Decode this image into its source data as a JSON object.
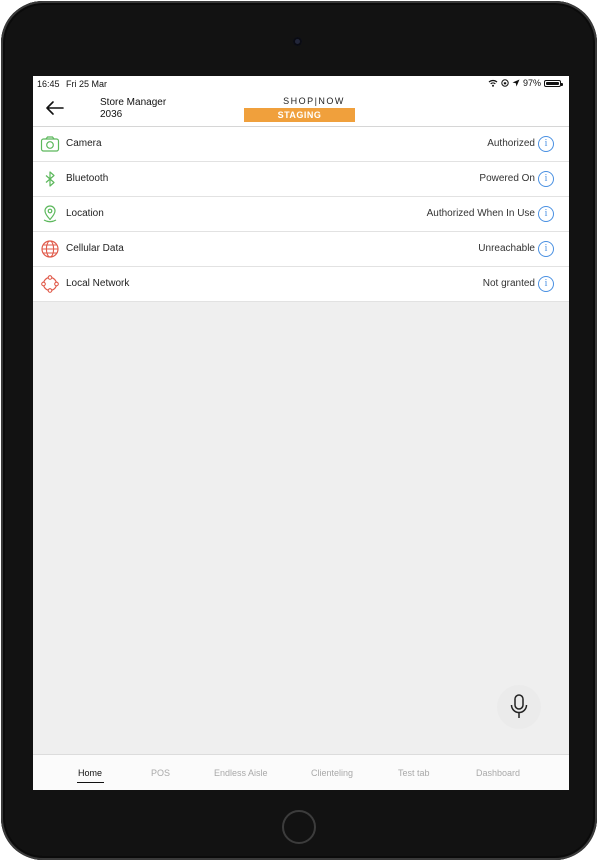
{
  "statusbar": {
    "time": "16:45",
    "date": "Fri 25 Mar",
    "battery": "97%",
    "battery_level": 0.97,
    "icons": [
      "wifi-icon",
      "screen-lock-icon",
      "location-arrow-icon",
      "battery-icon"
    ]
  },
  "header": {
    "store_name": "Store Manager",
    "store_id": "2036",
    "brand": "SHOP|NOW",
    "environment": "STAGING",
    "environment_color": "#f0a03c",
    "back_icon": "arrow-left-icon"
  },
  "permissions": [
    {
      "name": "Camera",
      "status": "Authorized",
      "icon": "camera-icon",
      "color": "#5cb85c"
    },
    {
      "name": "Bluetooth",
      "status": "Powered On",
      "icon": "bluetooth-icon",
      "color": "#5cb85c"
    },
    {
      "name": "Location",
      "status": "Authorized When In Use",
      "icon": "location-pin-icon",
      "color": "#5cb85c"
    },
    {
      "name": "Cellular Data",
      "status": "Unreachable",
      "icon": "globe-icon",
      "color": "#e05a4a"
    },
    {
      "name": "Local Network",
      "status": "Not granted",
      "icon": "local-network-icon",
      "color": "#e05a4a"
    }
  ],
  "info_icon": "info-icon",
  "info_color": "#4a90e2",
  "mic_icon": "microphone-icon",
  "tabs": [
    {
      "label": "Home",
      "active": true
    },
    {
      "label": "POS",
      "active": false
    },
    {
      "label": "Endless Aisle",
      "active": false
    },
    {
      "label": "Clienteling",
      "active": false
    },
    {
      "label": "Test tab",
      "active": false
    },
    {
      "label": "Dashboard",
      "active": false
    }
  ]
}
